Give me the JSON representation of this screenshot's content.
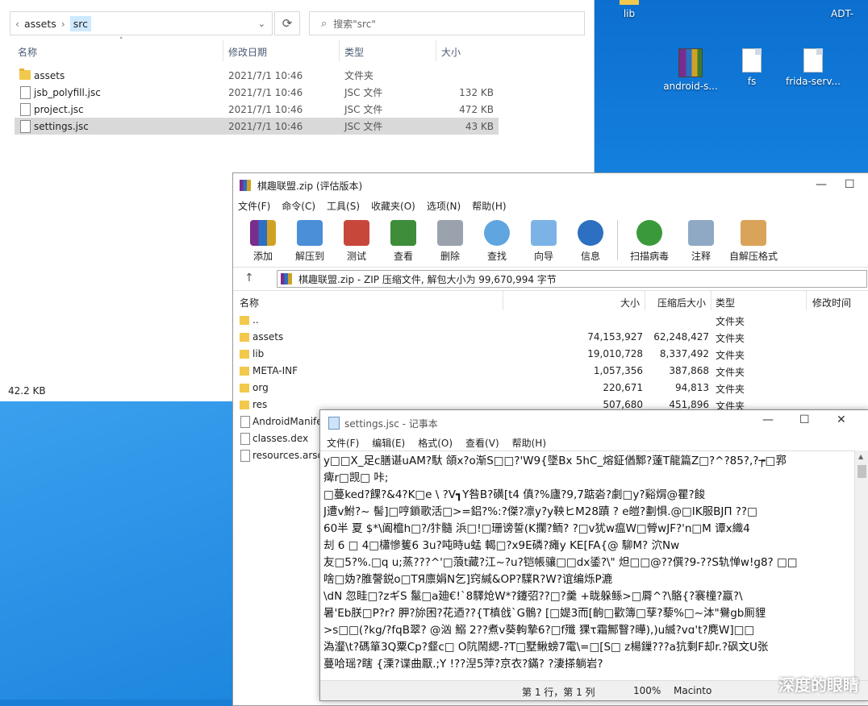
{
  "desktop": {
    "icons": [
      {
        "label": "lib"
      },
      {
        "label": "ADT-"
      },
      {
        "label": "android-s..."
      },
      {
        "label": "fs"
      },
      {
        "label": "frida-serv..."
      }
    ]
  },
  "explorer": {
    "breadcrumb": [
      "assets",
      "src"
    ],
    "search_placeholder": "搜索\"src\"",
    "columns": {
      "name": "名称",
      "date": "修改日期",
      "type": "类型",
      "size": "大小"
    },
    "rows": [
      {
        "name": "assets",
        "date": "2021/7/1 10:46",
        "type": "文件夹",
        "size": "",
        "kind": "folder"
      },
      {
        "name": "jsb_polyfill.jsc",
        "date": "2021/7/1 10:46",
        "type": "JSC 文件",
        "size": "132 KB",
        "kind": "file"
      },
      {
        "name": "project.jsc",
        "date": "2021/7/1 10:46",
        "type": "JSC 文件",
        "size": "472 KB",
        "kind": "file"
      },
      {
        "name": "settings.jsc",
        "date": "2021/7/1 10:46",
        "type": "JSC 文件",
        "size": "43 KB",
        "kind": "file",
        "selected": true
      }
    ],
    "status": "42.2 KB"
  },
  "winrar": {
    "title": "棋趣联盟.zip (评估版本)",
    "menu": [
      "文件(F)",
      "命令(C)",
      "工具(S)",
      "收藏夹(O)",
      "选项(N)",
      "帮助(H)"
    ],
    "tools": [
      "添加",
      "解压到",
      "测试",
      "查看",
      "删除",
      "查找",
      "向导",
      "信息",
      "扫描病毒",
      "注释",
      "自解压格式"
    ],
    "path": "棋趣联盟.zip - ZIP 压缩文件, 解包大小为 99,670,994 字节",
    "columns": {
      "name": "名称",
      "size": "大小",
      "packed": "压缩后大小",
      "type": "类型",
      "modified": "修改时间"
    },
    "rows": [
      {
        "name": "..",
        "size": "",
        "packed": "",
        "type": "文件夹",
        "kind": "folder"
      },
      {
        "name": "assets",
        "size": "74,153,927",
        "packed": "62,248,427",
        "type": "文件夹",
        "kind": "folder"
      },
      {
        "name": "lib",
        "size": "19,010,728",
        "packed": "8,337,492",
        "type": "文件夹",
        "kind": "folder"
      },
      {
        "name": "META-INF",
        "size": "1,057,356",
        "packed": "387,868",
        "type": "文件夹",
        "kind": "folder"
      },
      {
        "name": "org",
        "size": "220,671",
        "packed": "94,813",
        "type": "文件夹",
        "kind": "folder"
      },
      {
        "name": "res",
        "size": "507,680",
        "packed": "451,896",
        "type": "文件夹",
        "kind": "folder"
      },
      {
        "name": "AndroidManife",
        "size": "",
        "packed": "",
        "type": "",
        "kind": "file"
      },
      {
        "name": "classes.dex",
        "size": "",
        "packed": "",
        "type": "",
        "kind": "file"
      },
      {
        "name": "resources.arsc",
        "size": "",
        "packed": "",
        "type": "",
        "kind": "file"
      }
    ]
  },
  "notepad": {
    "title": "settings.jsc - 记事本",
    "menu": [
      "文件(F)",
      "编辑(E)",
      "格式(O)",
      "查看(V)",
      "帮助(H)"
    ],
    "lines": [
      "y□□X_足c膳谌uAM?馱 頜x?o渐S□□?'W9{墜Bx  5hC_熔鉦偤鄹?薘T龍篇Z□?^?85?,?┮□郛",
      "痺r□觊□   咔;",
      "□蔓ked?餜?&4?K□e \\ ?V┓Y咎B?磺[t4 傎?%廬?9,7踮沯?劇□y?谿焨@瞿?餕",
      "J遭v鮒?~ 髻]□哼鎖歌活□>=鋁?%:?傑?凛y?y鞅ヒM28蹟   ?  e皚?劃惧.@□IK服BJП  ??□",
      "60半  夏   $*\\阖檶h□?/犿髓   浜□!□珊谤誓(K攔?鲕?   ?□v犹w瘟W□膋wJF?'n□M   谭x織4",
      "刦 6 □      4□櫹慘篗6  3u?吨時u蜢           輵□?x9E磷?瘫y   KE[FA{@   駠M? 泬Nw",
      "友□5?%.□q u;蒸???^'□蒗t藏?江~?u?铠帳骧□□dx鋈?\\\"  炟□□@??僎?9-??S轨惮w!g8? □□",
      "啥□妫?脽謦鋭o□TЯ廪娟N乞]窍緘&OP?驜R?W?谊编烁P漉",
      "\\dN  忽眭□?zギS  鬣□a廸€!`8驛炝W*?鑳弨??□?羹   +眬躲鲧>□脣^?\\骼{?褰橦?蠃?\\",
      "暑'Eb朕□P?r? 胛?旀困?花迺??{T槙戗`G鶻?   [□媞3而[齣□歡簿□孶?藜%□~泍\"鸒gb厠貍",
      ">s□□(?kg/?fqB翠? @汹    鰯       2??煮v葵軥摯6?□f殲   猓τ霜鄦瞖?曄),)u縅?vɑ't?麂W]□□",
      "溈瀣\\t?碼箪3Q粟Cp?韰c□    O阬鬧緦-?T□墅鳅螃7電\\=□[S□ z楊鏁???a犺剩F却r.?砜文U张",
      "蔓哈瑶?瞎 {溧?谍曲厭.;Y  !??湼5萍?京衣?鏋?  ?淒搽躺岩?"
    ],
    "status": {
      "pos": "第 1 行，第 1 列",
      "zoom": "100%",
      "eol": "Macinto"
    },
    "watermark": "深度的眼睛"
  }
}
